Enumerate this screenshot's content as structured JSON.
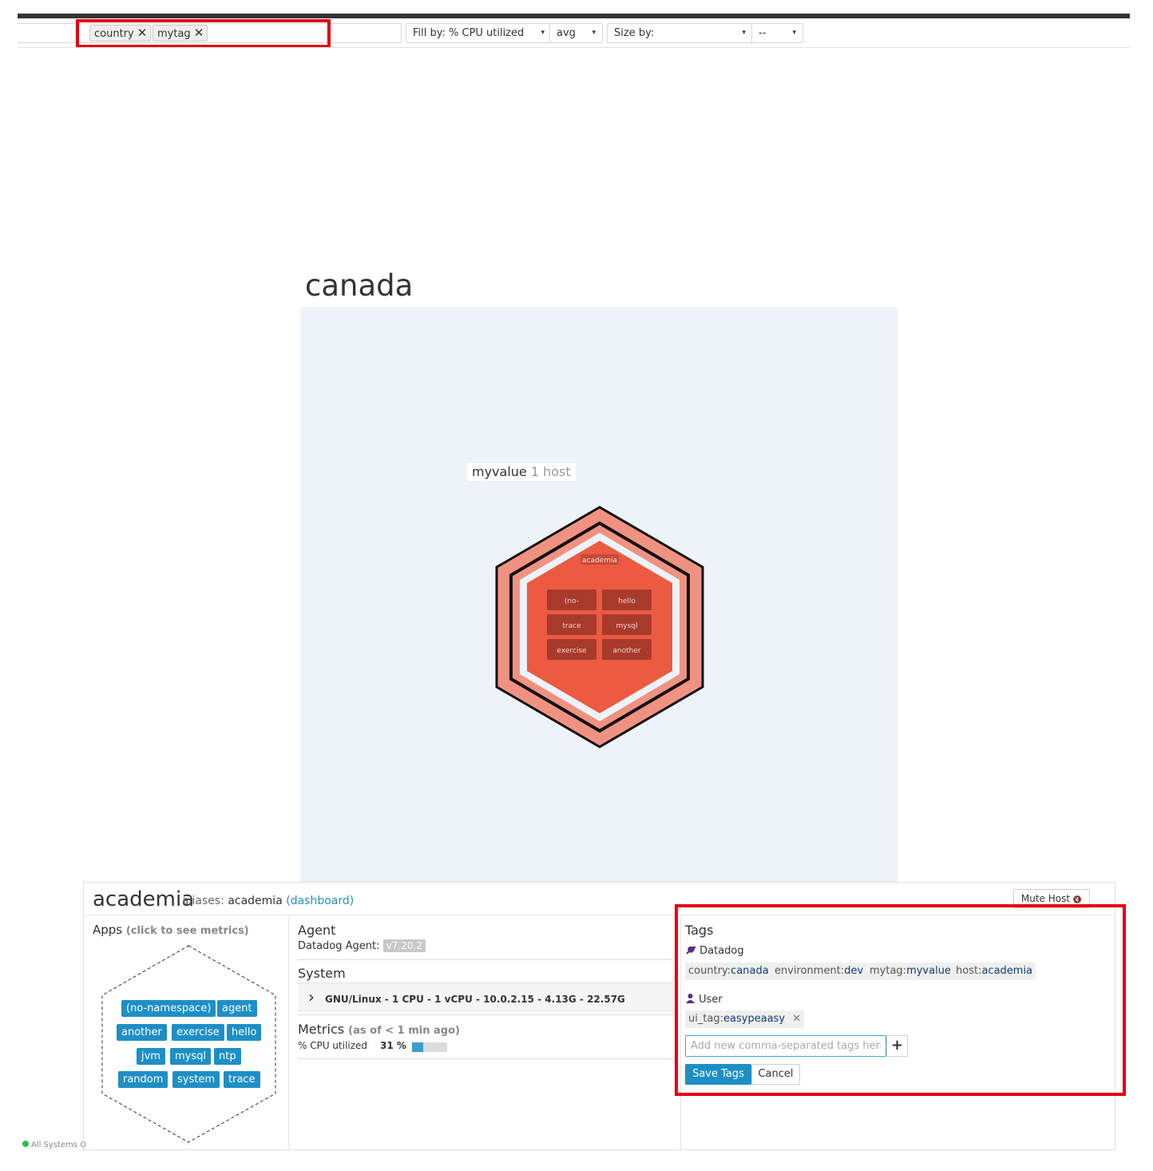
{
  "filters": {
    "group_by_tags": [
      "country",
      "mytag"
    ],
    "remove_icon": "✕",
    "fill_by": "Fill by: % CPU utilized",
    "aggregation": "avg",
    "size_by": "Size by:",
    "size_agg": "--",
    "caret": "▾"
  },
  "map": {
    "group_title": "canada",
    "subgroup_name": "myvalue",
    "subgroup_count": "1 host",
    "host_label": "academia",
    "cells": [
      "(no-",
      "hello",
      "trace",
      "mysql",
      "exercise",
      "another"
    ]
  },
  "host": {
    "name": "academia",
    "aliases_label": "aliases:",
    "aliases_value": "academia",
    "dashboard_link": "(dashboard)",
    "mute_label": "Mute Host",
    "mute_icon": "🔇",
    "apps_title": "Apps",
    "apps_hint": "(click to see metrics)",
    "apps": [
      "(no-namespace)",
      "agent",
      "another",
      "exercise",
      "hello",
      "jvm",
      "mysql",
      "ntp",
      "random",
      "system",
      "trace"
    ],
    "agent_title": "Agent",
    "agent_label": "Datadog Agent:",
    "agent_version": "v7.20.2",
    "system_title": "System",
    "system_chevron": "›",
    "system_summary": "GNU/Linux - 1 CPU - 1 vCPU - 10.0.2.15 - 4.13G - 22.57G",
    "metrics_title": "Metrics",
    "metrics_as_of": "(as of < 1 min ago)",
    "metric_name": "% CPU utilized",
    "metric_value": "31 %",
    "metric_fraction": 0.31
  },
  "tags": {
    "title": "Tags",
    "datadog_label": "Datadog",
    "datadog_icon": "wrench-icon",
    "datadog_tags": [
      {
        "key": "country:",
        "value": "canada"
      },
      {
        "key": "environment:",
        "value": "dev"
      },
      {
        "key": "mytag:",
        "value": "myvalue"
      },
      {
        "key": "host:",
        "value": "academia"
      }
    ],
    "user_label": "User",
    "user_icon": "user-icon",
    "user_tags": [
      {
        "key": "ui_tag:",
        "value": "easypeaasy"
      }
    ],
    "remove_icon": "✕",
    "input_placeholder": "Add new comma-separated tags here",
    "add_icon": "+",
    "save_label": "Save Tags",
    "cancel_label": "Cancel"
  },
  "colors": {
    "accent": "#1e8fc6",
    "highlight": "#e60012",
    "hex_fill": "#ec5a42",
    "hex_ring": "#f09282",
    "cell": "#a83a2c"
  },
  "status": {
    "text": "All Systems O"
  }
}
